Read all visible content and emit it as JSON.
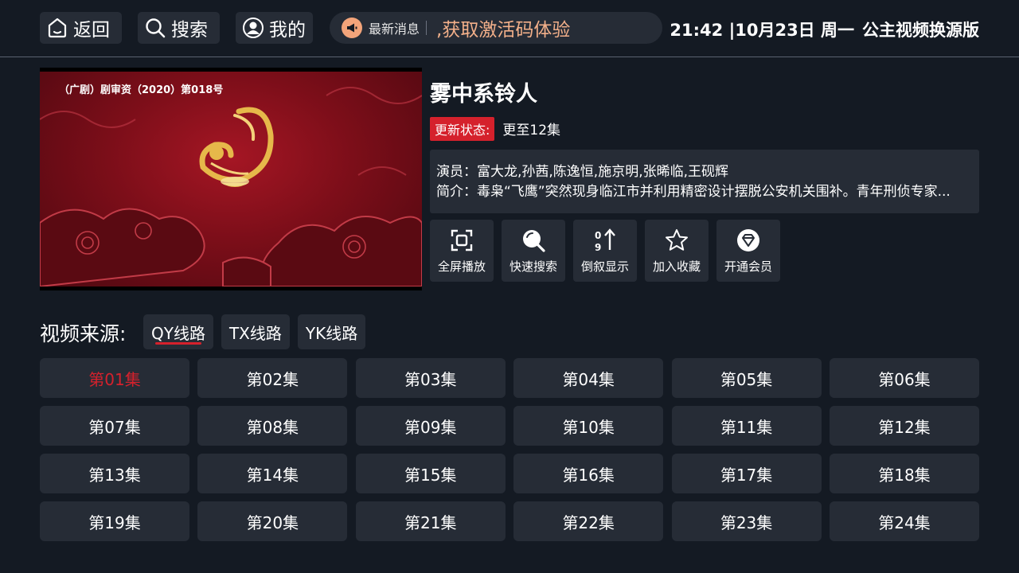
{
  "header": {
    "back_label": "返回",
    "search_label": "搜索",
    "mine_label": "我的",
    "news_label": "最新消息",
    "news_text": ",获取激活码体验",
    "time": "21:42 |10月23日 周一",
    "app_name": "公主视频换源版"
  },
  "player": {
    "license_text": "（广剧）剧审资（2020）第018号"
  },
  "show": {
    "title": "雾中系铃人",
    "status_tag": "更新状态:",
    "status_value": "更至12集",
    "cast": "演员：富大龙,孙茜,陈逸恒,施京明,张晞临,王砚辉",
    "synopsis": "简介：毒枭“飞鹰”突然现身临江市并利用精密设计摆脱公安机关围补。青年刑侦专家..."
  },
  "actions": [
    {
      "label": "全屏播放",
      "icon": "fullscreen-icon"
    },
    {
      "label": "快速搜索",
      "icon": "search-icon"
    },
    {
      "label": "倒叙显示",
      "icon": "sort-icon"
    },
    {
      "label": "加入收藏",
      "icon": "star-icon"
    },
    {
      "label": "开通会员",
      "icon": "vip-diamond-icon"
    }
  ],
  "source": {
    "label": "视频来源:",
    "tabs": [
      "QY线路",
      "TX线路",
      "YK线路"
    ],
    "active_tab": "QY线路"
  },
  "episodes": [
    "第01集",
    "第02集",
    "第03集",
    "第04集",
    "第05集",
    "第06集",
    "第07集",
    "第08集",
    "第09集",
    "第10集",
    "第11集",
    "第12集",
    "第13集",
    "第14集",
    "第15集",
    "第16集",
    "第17集",
    "第18集",
    "第19集",
    "第20集",
    "第21集",
    "第22集",
    "第23集",
    "第24集"
  ],
  "current_episode": "第01集",
  "colors": {
    "background": "#141a23",
    "panel": "#262c36",
    "accent_red": "#d5212c",
    "news_orange": "#f3b08a"
  }
}
